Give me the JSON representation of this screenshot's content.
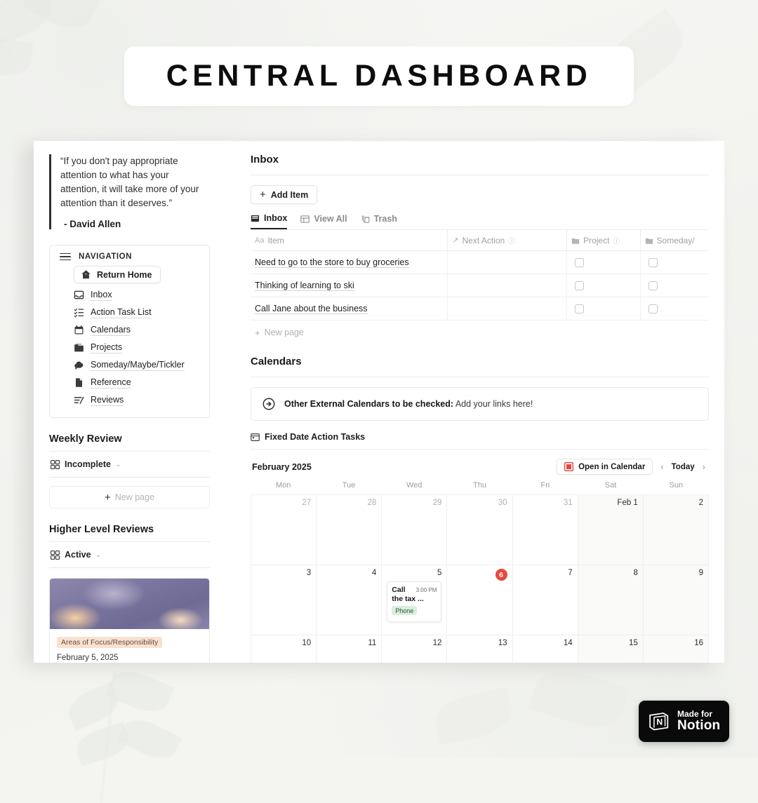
{
  "banner": {
    "title": "CENTRAL DASHBOARD"
  },
  "sidebar": {
    "quote": {
      "text": "“If you don't pay appropriate attention to what has your attention, it will take more of your attention than it deserves.”",
      "author": "- David Allen"
    },
    "navigation": {
      "header": "NAVIGATION",
      "home_button": "Return Home",
      "items": [
        {
          "label": "Inbox",
          "icon": "inbox-tray-icon"
        },
        {
          "label": "Action Task List",
          "icon": "checklist-icon"
        },
        {
          "label": "Calendars",
          "icon": "calendar-icon"
        },
        {
          "label": "Projects",
          "icon": "folder-icon"
        },
        {
          "label": "Someday/Maybe/Tickler",
          "icon": "cloud-icon"
        },
        {
          "label": "Reference",
          "icon": "document-icon"
        },
        {
          "label": "Reviews",
          "icon": "review-pencil-icon"
        }
      ]
    },
    "weekly_review": {
      "title": "Weekly Review",
      "view": "Incomplete",
      "new_page": "New page"
    },
    "higher_level_reviews": {
      "title": "Higher Level Reviews",
      "view": "Active"
    },
    "card": {
      "tag": "Areas of Focus/Responsibility",
      "date": "February 5, 2025"
    }
  },
  "main": {
    "inbox": {
      "title": "Inbox",
      "add_item": "Add Item",
      "tabs": [
        {
          "label": "Inbox",
          "icon": "inbox-icon",
          "active": true
        },
        {
          "label": "View All",
          "icon": "table-icon",
          "active": false
        },
        {
          "label": "Trash",
          "icon": "trash-icon",
          "active": false
        }
      ],
      "columns": [
        "Item",
        "Next Action",
        "Project",
        "Someday/"
      ],
      "rows": [
        {
          "item": "Need to go to the store to buy groceries"
        },
        {
          "item": "Thinking of learning to ski"
        },
        {
          "item": "Call Jane about the business"
        }
      ],
      "new_page": "New page"
    },
    "calendars": {
      "title": "Calendars",
      "callout": {
        "bold": "Other External Calendars to be checked:",
        "rest": " Add your links here!"
      },
      "fixed_date_label": "Fixed Date Action Tasks",
      "month": "February 2025",
      "open_in_calendar": "Open in Calendar",
      "today": "Today",
      "weekdays": [
        "Mon",
        "Tue",
        "Wed",
        "Thu",
        "Fri",
        "Sat",
        "Sun"
      ],
      "weeks": [
        [
          {
            "day": "27",
            "muted": true
          },
          {
            "day": "28",
            "muted": true
          },
          {
            "day": "29",
            "muted": true
          },
          {
            "day": "30",
            "muted": true
          },
          {
            "day": "31",
            "muted": true
          },
          {
            "day": "Feb 1",
            "muted": false,
            "weekend": true
          },
          {
            "day": "2",
            "muted": false,
            "weekend": true
          }
        ],
        [
          {
            "day": "3",
            "muted": false
          },
          {
            "day": "4",
            "muted": false
          },
          {
            "day": "5",
            "muted": false,
            "event": {
              "title_line1": "Call",
              "title_line2": "the tax ...",
              "time": "3:00 PM",
              "tag": "Phone"
            }
          },
          {
            "day": "6",
            "muted": false,
            "today": true
          },
          {
            "day": "7",
            "muted": false
          },
          {
            "day": "8",
            "muted": false,
            "weekend": true
          },
          {
            "day": "9",
            "muted": false,
            "weekend": true
          }
        ],
        [
          {
            "day": "10",
            "muted": false
          },
          {
            "day": "11",
            "muted": false
          },
          {
            "day": "12",
            "muted": false
          },
          {
            "day": "13",
            "muted": false
          },
          {
            "day": "14",
            "muted": false
          },
          {
            "day": "15",
            "muted": false,
            "weekend": true
          },
          {
            "day": "16",
            "muted": false,
            "weekend": true
          }
        ]
      ]
    }
  },
  "badge": {
    "made_for": "Made for",
    "notion": "Notion"
  },
  "colors": {
    "today_red": "#e8483f",
    "tag_green_bg": "#daeedd",
    "tag_peach_bg": "#f7e2d2",
    "accent_dark": "#0a0a0a"
  }
}
